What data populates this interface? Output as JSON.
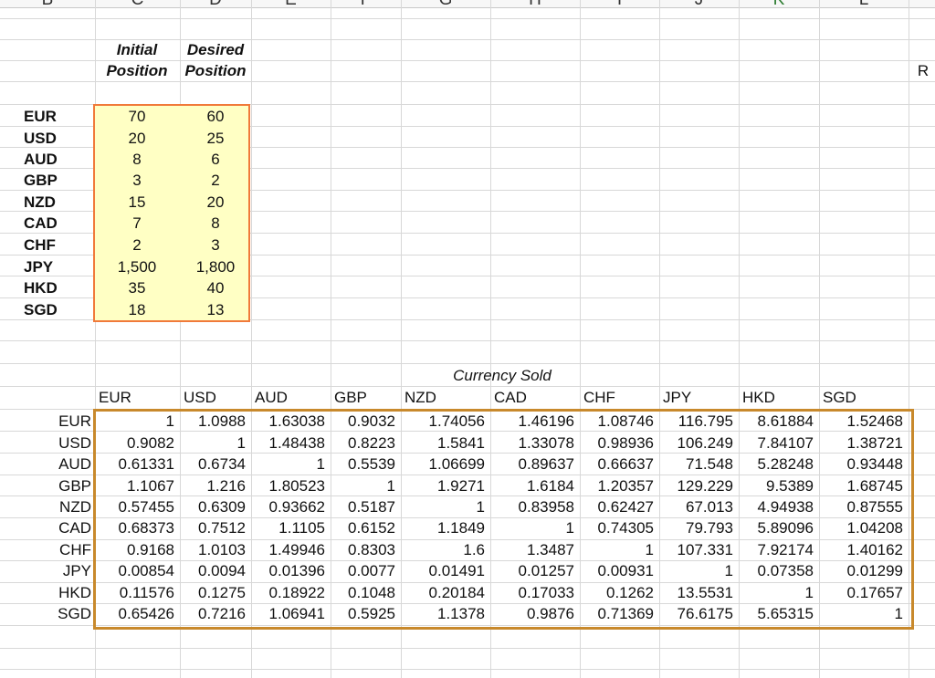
{
  "column_letters": [
    "B",
    "C",
    "D",
    "E",
    "F",
    "G",
    "H",
    "I",
    "J",
    "K",
    "L"
  ],
  "right_edge_label": "R",
  "positions": {
    "header_initial": [
      "Initial",
      "Position"
    ],
    "header_desired": [
      "Desired",
      "Position"
    ],
    "rows": [
      {
        "currency": "EUR",
        "initial": "70",
        "desired": "60"
      },
      {
        "currency": "USD",
        "initial": "20",
        "desired": "25"
      },
      {
        "currency": "AUD",
        "initial": "8",
        "desired": "6"
      },
      {
        "currency": "GBP",
        "initial": "3",
        "desired": "2"
      },
      {
        "currency": "NZD",
        "initial": "15",
        "desired": "20"
      },
      {
        "currency": "CAD",
        "initial": "7",
        "desired": "8"
      },
      {
        "currency": "CHF",
        "initial": "2",
        "desired": "3"
      },
      {
        "currency": "JPY",
        "initial": "1,500",
        "desired": "1,800"
      },
      {
        "currency": "HKD",
        "initial": "35",
        "desired": "40"
      },
      {
        "currency": "SGD",
        "initial": "18",
        "desired": "13"
      }
    ]
  },
  "rates": {
    "title": "Currency Sold",
    "columns": [
      "EUR",
      "USD",
      "AUD",
      "GBP",
      "NZD",
      "CAD",
      "CHF",
      "JPY",
      "HKD",
      "SGD"
    ],
    "rows": [
      {
        "label": "EUR",
        "values": [
          "1",
          "1.0988",
          "1.63038",
          "0.9032",
          "1.74056",
          "1.46196",
          "1.08746",
          "116.795",
          "8.61884",
          "1.52468"
        ]
      },
      {
        "label": "USD",
        "values": [
          "0.9082",
          "1",
          "1.48438",
          "0.8223",
          "1.5841",
          "1.33078",
          "0.98936",
          "106.249",
          "7.84107",
          "1.38721"
        ]
      },
      {
        "label": "AUD",
        "values": [
          "0.61331",
          "0.6734",
          "1",
          "0.5539",
          "1.06699",
          "0.89637",
          "0.66637",
          "71.548",
          "5.28248",
          "0.93448"
        ]
      },
      {
        "label": "GBP",
        "values": [
          "1.1067",
          "1.216",
          "1.80523",
          "1",
          "1.9271",
          "1.6184",
          "1.20357",
          "129.229",
          "9.5389",
          "1.68745"
        ]
      },
      {
        "label": "NZD",
        "values": [
          "0.57455",
          "0.6309",
          "0.93662",
          "0.5187",
          "1",
          "0.83958",
          "0.62427",
          "67.013",
          "4.94938",
          "0.87555"
        ]
      },
      {
        "label": "CAD",
        "values": [
          "0.68373",
          "0.7512",
          "1.1105",
          "0.6152",
          "1.1849",
          "1",
          "0.74305",
          "79.793",
          "5.89096",
          "1.04208"
        ]
      },
      {
        "label": "CHF",
        "values": [
          "0.9168",
          "1.0103",
          "1.49946",
          "0.8303",
          "1.6",
          "1.3487",
          "1",
          "107.331",
          "7.92174",
          "1.40162"
        ]
      },
      {
        "label": "JPY",
        "values": [
          "0.00854",
          "0.0094",
          "0.01396",
          "0.0077",
          "0.01491",
          "0.01257",
          "0.00931",
          "1",
          "0.07358",
          "0.01299"
        ]
      },
      {
        "label": "HKD",
        "values": [
          "0.11576",
          "0.1275",
          "0.18922",
          "0.1048",
          "0.20184",
          "0.17033",
          "0.1262",
          "13.5531",
          "1",
          "0.17657"
        ]
      },
      {
        "label": "SGD",
        "values": [
          "0.65426",
          "0.7216",
          "1.06941",
          "0.5925",
          "1.1378",
          "0.9876",
          "0.71369",
          "76.6175",
          "5.65315",
          "1"
        ]
      }
    ]
  },
  "colors": {
    "highlight_fill": "#ffffc4",
    "highlight_border": "#f07a3a",
    "matrix_border": "#c8892c",
    "gridline": "#d8d8d8"
  }
}
